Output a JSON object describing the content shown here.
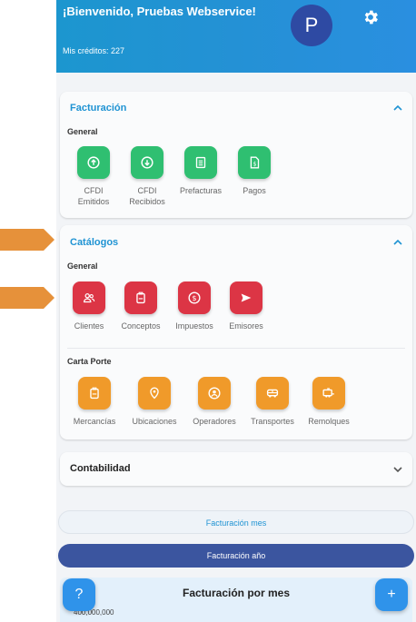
{
  "header": {
    "welcome": "¡Bienvenido, Pruebas Webservice!",
    "credits": "Mis créditos: 227",
    "avatar_letter": "P"
  },
  "facturacion": {
    "title": "Facturación",
    "subtitle": "General",
    "items": [
      {
        "label": "CFDI\nEmitidos",
        "icon": "upload-circle-icon"
      },
      {
        "label": "CFDI\nRecibidos",
        "icon": "download-circle-icon"
      },
      {
        "label": "Prefacturas",
        "icon": "document-list-icon"
      },
      {
        "label": "Pagos",
        "icon": "receipt-dollar-icon"
      }
    ]
  },
  "catalogos": {
    "title": "Catálogos",
    "general_subtitle": "General",
    "general_items": [
      {
        "label": "Clientes",
        "icon": "people-icon"
      },
      {
        "label": "Conceptos",
        "icon": "box-icon"
      },
      {
        "label": "Impuestos",
        "icon": "dollar-circle-icon"
      },
      {
        "label": "Emisores",
        "icon": "send-icon"
      }
    ],
    "carta_subtitle": "Carta Porte",
    "carta_items": [
      {
        "label": "Mercancías",
        "icon": "package-icon"
      },
      {
        "label": "Ubicaciones",
        "icon": "location-pin-icon"
      },
      {
        "label": "Operadores",
        "icon": "user-circle-icon"
      },
      {
        "label": "Transportes",
        "icon": "bus-icon"
      },
      {
        "label": "Remolques",
        "icon": "trailer-icon"
      }
    ]
  },
  "contabilidad": {
    "title": "Contabilidad"
  },
  "buttons": {
    "mes": "Facturación mes",
    "anio": "Facturación año"
  },
  "chart": {
    "title": "Facturación por mes",
    "first_tick": "400,000,000"
  },
  "fab": {
    "help": "?",
    "add": "+"
  },
  "colors": {
    "header": "#1f93d3",
    "green": "#2fbf71",
    "red": "#dc3545",
    "orange": "#f09a2a",
    "dark_button": "#3b559f"
  }
}
